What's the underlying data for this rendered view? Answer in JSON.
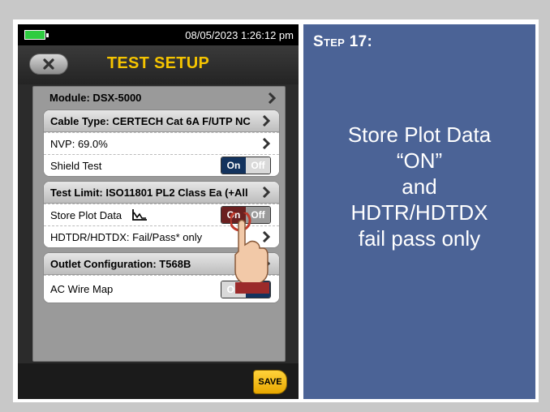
{
  "device": {
    "status_time": "08/05/2023 1:26:12 pm",
    "title": "TEST SETUP",
    "save_label": "SAVE"
  },
  "groups": [
    {
      "rows": [
        {
          "label": "Module: DSX-5000",
          "style": "hdr-plain"
        }
      ]
    },
    {
      "rows": [
        {
          "label": "Cable Type: CERTECH Cat 6A F/UTP NC",
          "style": "hdr"
        },
        {
          "label": "NVP: 69.0%"
        },
        {
          "label": "Shield Test",
          "toggle_on": "On",
          "toggle_off": "Off"
        }
      ]
    },
    {
      "rows": [
        {
          "label": "Test Limit: ISO11801 PL2 Class Ea (+All",
          "style": "hdr"
        },
        {
          "label": "Store Plot Data",
          "toggle_on": "On",
          "toggle_off": "Off"
        },
        {
          "label": "HDTDR/HDTDX: Fail/Pass* only"
        }
      ]
    },
    {
      "rows": [
        {
          "label": "Outlet Configuration: T568B",
          "style": "hdr"
        },
        {
          "label": "AC Wire Map",
          "toggle_on": "On",
          "toggle_off": "Off"
        }
      ]
    }
  ],
  "settings": {
    "shield_test": "On",
    "store_plot_data": "On",
    "ac_wire_map": "Off"
  },
  "instruction": {
    "step": "Step 17:",
    "lines": [
      "Store Plot Data",
      "“ON”",
      "and",
      "HDTR/HDTDX",
      "fail pass only"
    ]
  },
  "colors": {
    "accent_title": "#f5c400",
    "toggle_selected": "#13335e",
    "instruction_bg": "#4b6396"
  }
}
